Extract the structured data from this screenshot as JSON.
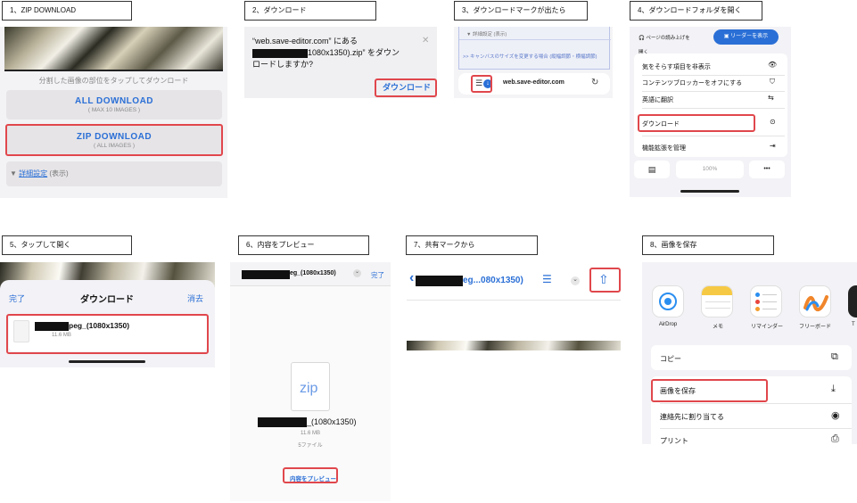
{
  "steps": {
    "s1": "1、ZIP DOWNLOAD",
    "s2": "2、ダウンロード",
    "s3": "3、ダウンロードマークが出たら",
    "s4": "4、ダウンロードフォルダを開く",
    "s5": "5、タップして開く",
    "s6": "6、内容をプレビュー",
    "s7": "7、共有マークから",
    "s8": "8、画像を保存"
  },
  "p1": {
    "hint": "分割した画像の部位をタップしてダウンロード",
    "all_title": "ALL DOWNLOAD",
    "all_sub": "( MAX 10 IMAGES )",
    "zip_title": "ZIP DOWNLOAD",
    "zip_sub": "( ALL IMAGES )",
    "detail_arrow": "▼",
    "detail_link": "詳細設定",
    "detail_show": "(表示)"
  },
  "p2": {
    "line1": "“web.save-editor.com” にある",
    "line2_suffix": "1080x1350).zip” をダウン",
    "line3": "ロードしますか?",
    "close": "✕",
    "download_btn": "ダウンロード"
  },
  "p3": {
    "top_text": "▼ 詳細設定 (表示)",
    "link_text": ">> キャンバスのサイズを変更する場合 (縦幅調節・横幅調節)",
    "url": "web.save-editor.com",
    "reload": "↻"
  },
  "p4": {
    "hide_btn": "ページの読み上げを開く",
    "reader_btn": "リーダーを表示",
    "rows": [
      {
        "label": "気をそらす項目を非表示",
        "icon": "👁"
      },
      {
        "label": "コンテンツブロッカーをオフにする",
        "icon": "⛉"
      },
      {
        "label": "英語に翻訳",
        "icon": "⇆"
      },
      {
        "label": "ダウンロード",
        "icon": "⊙"
      },
      {
        "label": "機能拡張を管理",
        "icon": "⇥"
      }
    ],
    "zoom": "100%",
    "more": "•••",
    "bookmark": "▤"
  },
  "p5": {
    "done": "完了",
    "title": "ダウンロード",
    "clear": "消去",
    "file_name": "peg_(1080x1350)",
    "file_size": "11.6 MB"
  },
  "p6": {
    "file_name": "eg_(1080x1350)",
    "chevron": "⌄",
    "done": "完了",
    "zip_label": "zip",
    "archive_name": "_(1080x1350)",
    "size": "11.6 MB",
    "files": "5ファイル",
    "preview_btn": "内容をプレビュー"
  },
  "p7": {
    "back": "‹",
    "title": "eg...080x1350)",
    "list_icon": "☰",
    "chevron": "⌄",
    "share_icon": "⇧"
  },
  "p8": {
    "apps": [
      "AirDrop",
      "メモ",
      "リマインダー",
      "フリーボード",
      "T"
    ],
    "actions": [
      {
        "label": "コピー",
        "icon": "⧉"
      },
      {
        "label": "画像を保存",
        "icon": "⤓"
      },
      {
        "label": "連絡先に割り当てる",
        "icon": "◉"
      },
      {
        "label": "プリント",
        "icon": "⎙"
      }
    ]
  },
  "colors": {
    "red": "#e0474c",
    "ios_blue": "#2a6fd6",
    "button_bg": "#e6e4e7"
  }
}
